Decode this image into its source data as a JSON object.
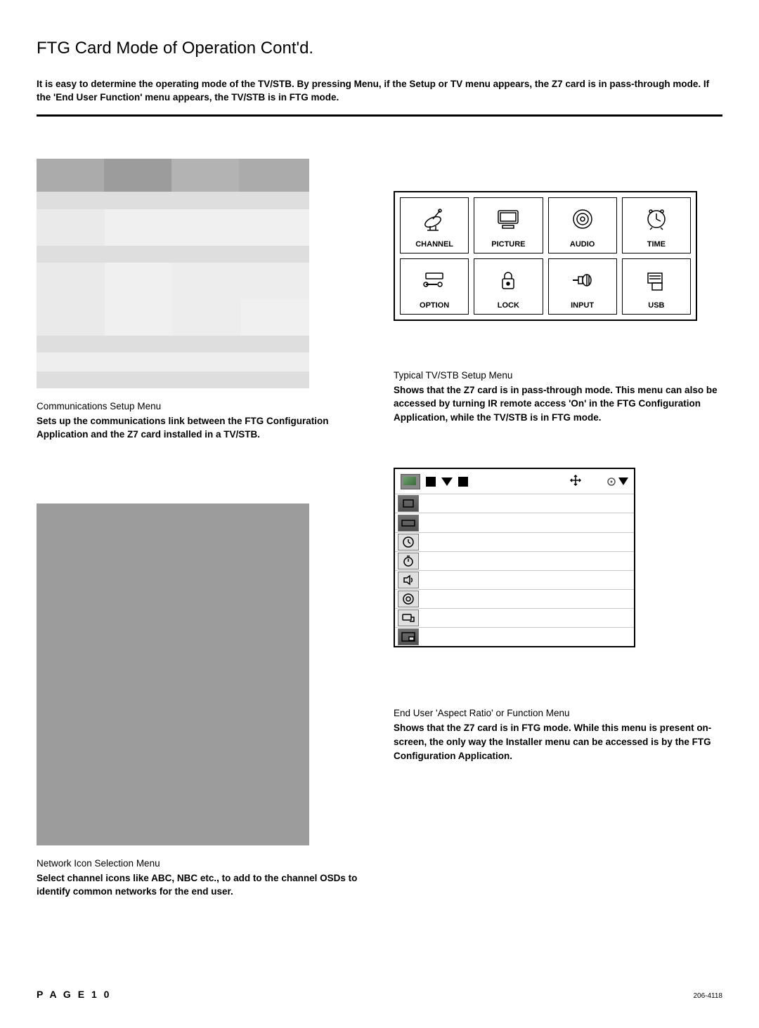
{
  "page": {
    "title": "FTG Card Mode of Operation Cont'd.",
    "intro": "It is easy to determine the operating mode of the TV/STB.  By pressing Menu, if the Setup or TV menu appears, the Z7 card is in pass-through mode. If the 'End User Function' menu appears, the TV/STB is in FTG mode.",
    "page_number": "P A G E   1 0",
    "document_number": "206-4118"
  },
  "comm_setup": {
    "caption_title": "Communications Setup Menu",
    "caption_body": "Sets up the communications link between the FTG Configuration Application and the Z7 card installed in a TV/STB."
  },
  "tv_setup": {
    "cells": {
      "channel": "CHANNEL",
      "picture": "PICTURE",
      "audio": "AUDIO",
      "time": "TIME",
      "option": "OPTION",
      "lock": "LOCK",
      "input": "INPUT",
      "usb": "USB"
    },
    "caption_title": "Typical TV/STB Setup Menu",
    "caption_body": "Shows that the Z7 card is in pass-through mode. This menu can also be accessed by turning IR remote access 'On' in the FTG Configuration Application, while the TV/STB is in FTG mode."
  },
  "network_icon": {
    "caption_title": "Network Icon Selection Menu",
    "caption_body": "Select channel icons like ABC, NBC etc., to add to the channel OSDs to identify common networks for the end user."
  },
  "end_user": {
    "caption_title": "End User 'Aspect Ratio' or Function Menu",
    "caption_body": "Shows that the Z7 card is in FTG mode. While this menu is present on-screen, the only way the Installer menu can be accessed is by the FTG Configuration Application."
  }
}
